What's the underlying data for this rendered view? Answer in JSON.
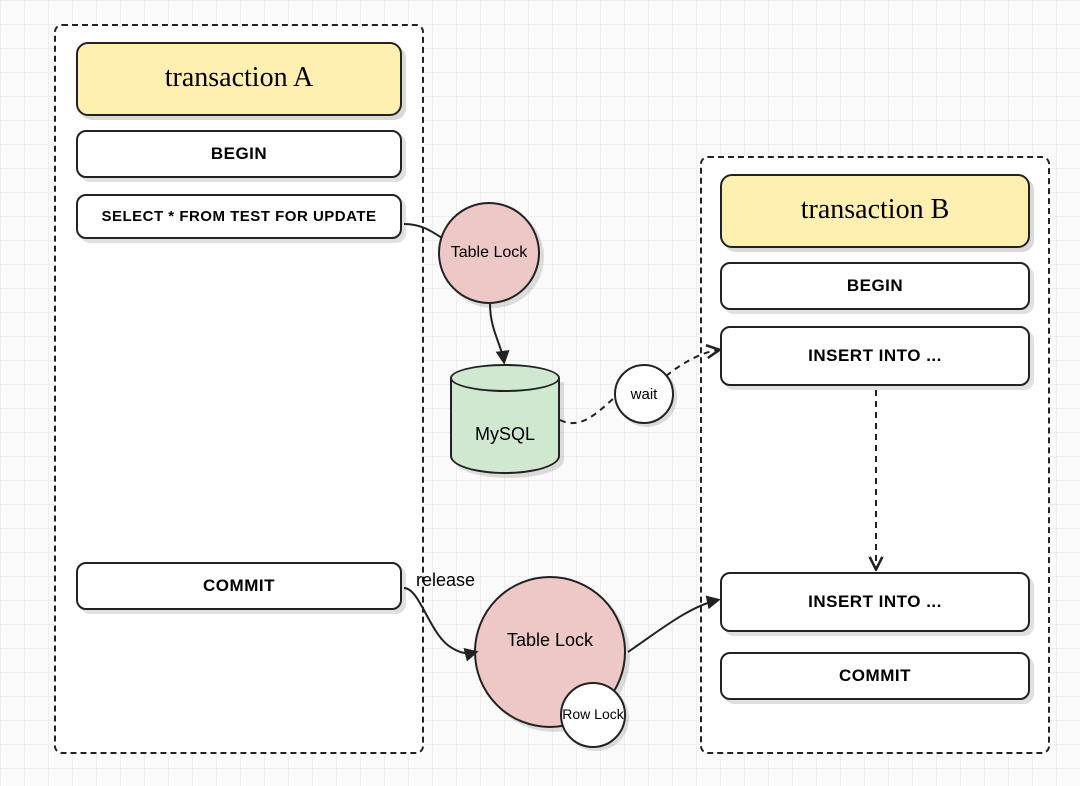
{
  "transactionA": {
    "title": "transaction A",
    "begin": "BEGIN",
    "select": "SELECT * FROM TEST FOR UPDATE",
    "commit": "COMMIT"
  },
  "transactionB": {
    "title": "transaction B",
    "begin": "BEGIN",
    "insert1": "INSERT INTO ...",
    "insert2": "INSERT INTO ...",
    "commit": "COMMIT"
  },
  "locks": {
    "table1": "Table Lock",
    "table2": "Table Lock",
    "row": "Row Lock"
  },
  "db": "MySQL",
  "wait": "wait",
  "release": "release"
}
